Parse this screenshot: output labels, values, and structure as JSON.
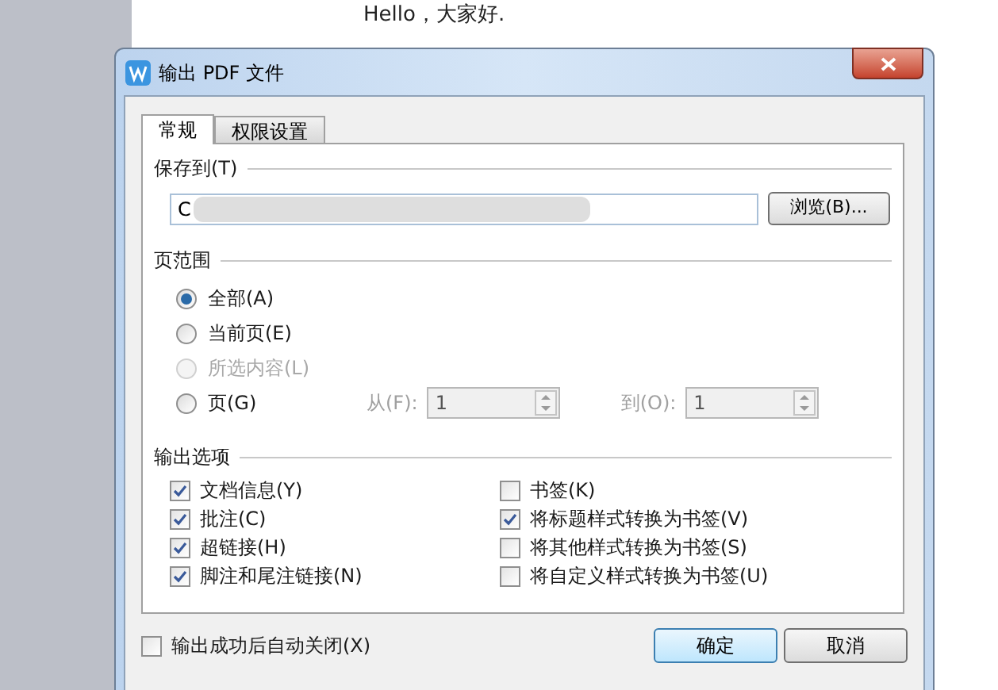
{
  "document": {
    "text": "Hello，大家好."
  },
  "dialog": {
    "title": "输出 PDF 文件",
    "tabs": [
      {
        "label": "常规",
        "selected": true
      },
      {
        "label": "权限设置",
        "selected": false
      }
    ],
    "save_to": {
      "label": "保存到(T)",
      "value": "C",
      "browse_button": "浏览(B)..."
    },
    "page_range": {
      "label": "页范围",
      "options": [
        {
          "label": "全部(A)",
          "selected": true,
          "disabled": false
        },
        {
          "label": "当前页(E)",
          "selected": false,
          "disabled": false
        },
        {
          "label": "所选内容(L)",
          "selected": false,
          "disabled": true
        },
        {
          "label": "页(G)",
          "selected": false,
          "disabled": false
        }
      ],
      "from": {
        "label": "从(F):",
        "value": "1",
        "disabled": true
      },
      "to": {
        "label": "到(O):",
        "value": "1",
        "disabled": true
      }
    },
    "output_options": {
      "label": "输出选项",
      "left": [
        {
          "label": "文档信息(Y)",
          "checked": true
        },
        {
          "label": "批注(C)",
          "checked": true
        },
        {
          "label": "超链接(H)",
          "checked": true
        },
        {
          "label": "脚注和尾注链接(N)",
          "checked": true
        }
      ],
      "right": [
        {
          "label": "书签(K)",
          "checked": false
        },
        {
          "label": "将标题样式转换为书签(V)",
          "checked": true
        },
        {
          "label": "将其他样式转换为书签(S)",
          "checked": false
        },
        {
          "label": "将自定义样式转换为书签(U)",
          "checked": false
        }
      ]
    },
    "auto_close": {
      "label": "输出成功后自动关闭(X)",
      "checked": false
    },
    "buttons": [
      {
        "label": "确定",
        "kind": "default"
      },
      {
        "label": "取消",
        "kind": "normal"
      }
    ]
  }
}
